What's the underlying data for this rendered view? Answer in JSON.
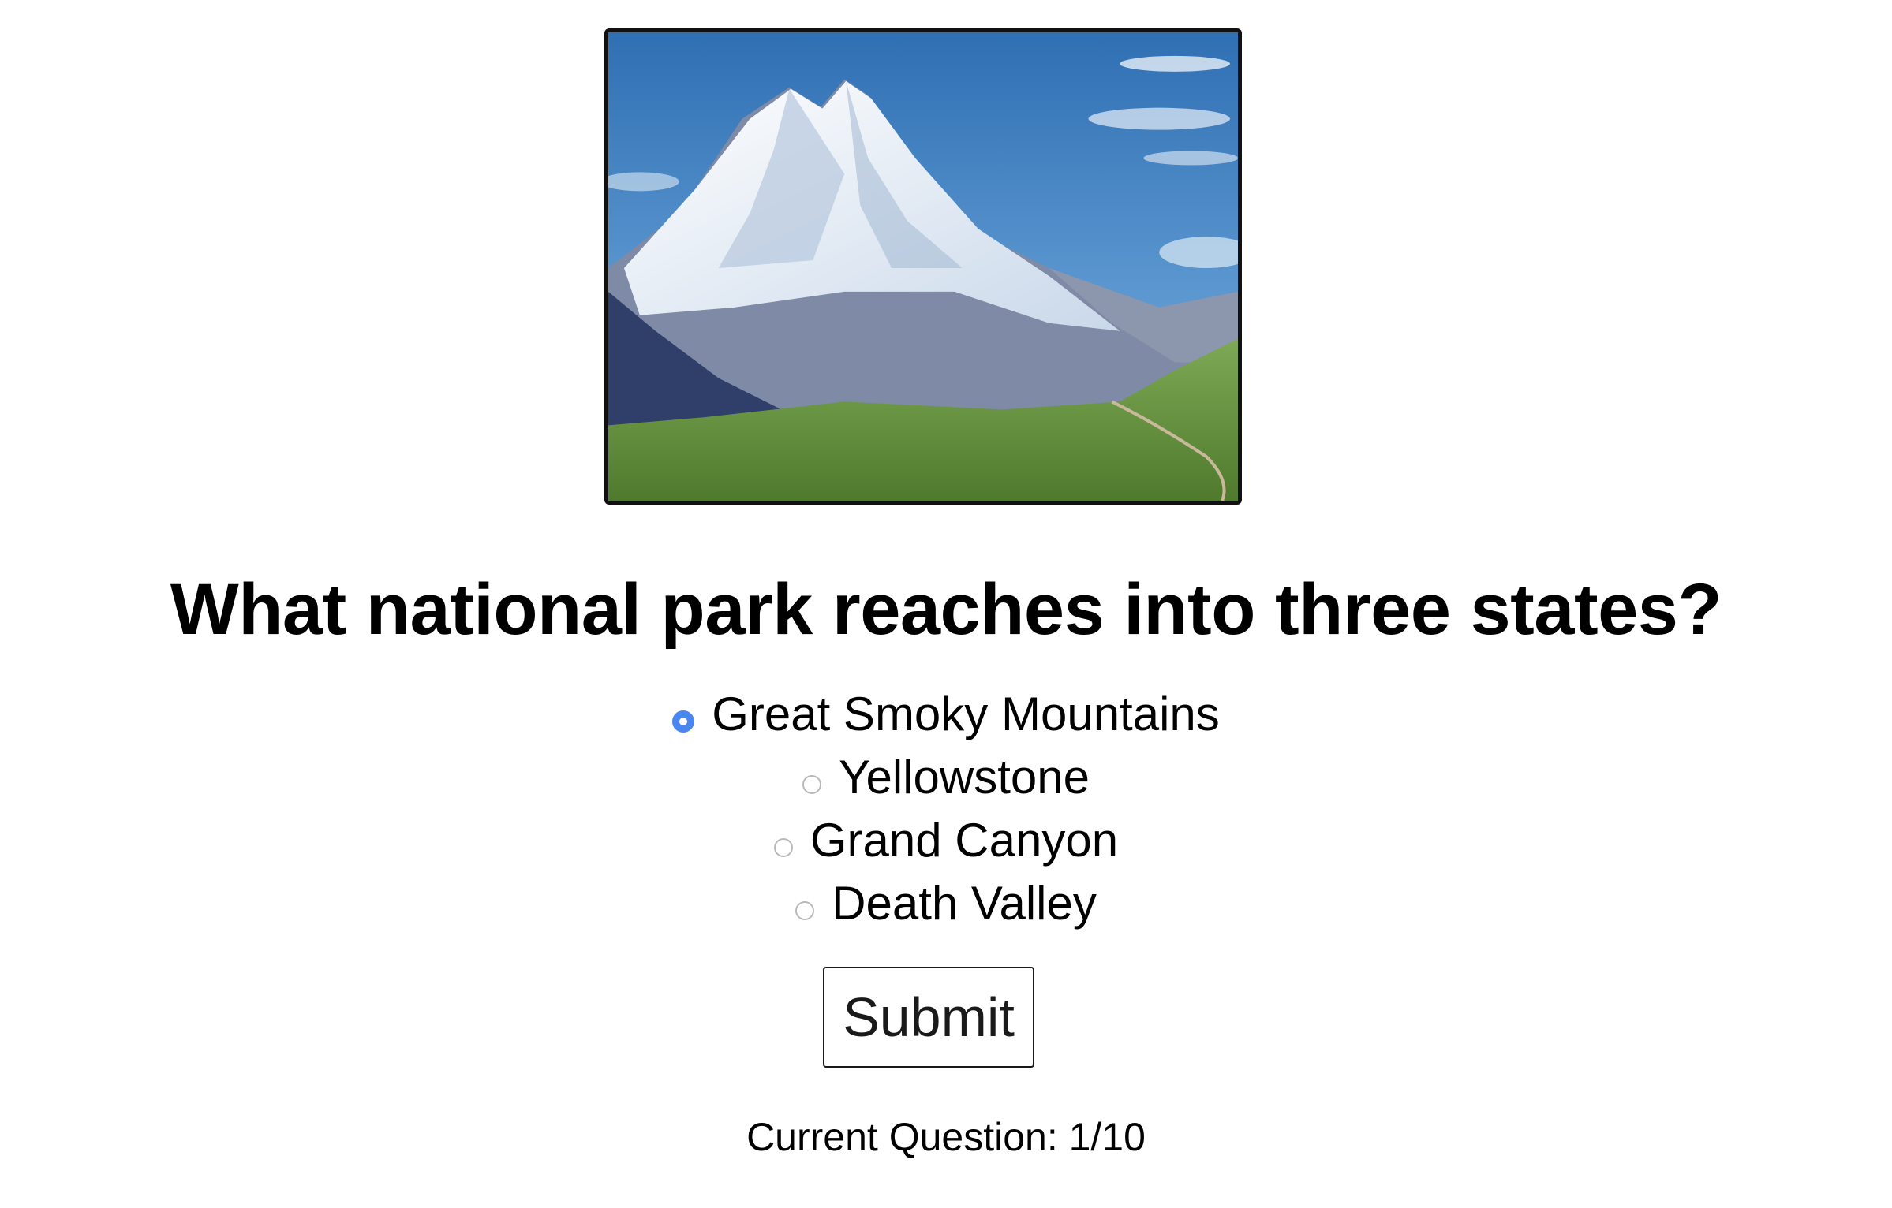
{
  "hero_image": {
    "icon": "mountain-landscape-photo",
    "sky_color": "#3d7fbe",
    "snow_color": "#f4f7fb",
    "grass_color": "#6e9a45"
  },
  "question": {
    "text": "What national park reaches into three states?"
  },
  "options": [
    {
      "label": "Great Smoky Mountains",
      "selected": true
    },
    {
      "label": "Yellowstone",
      "selected": false
    },
    {
      "label": "Grand Canyon",
      "selected": false
    },
    {
      "label": "Death Valley",
      "selected": false
    }
  ],
  "submit": {
    "label": "Submit"
  },
  "progress": {
    "text": "Current Question: 1/10"
  },
  "colors": {
    "radio_selected": "#4a86f0",
    "text": "#000000"
  }
}
